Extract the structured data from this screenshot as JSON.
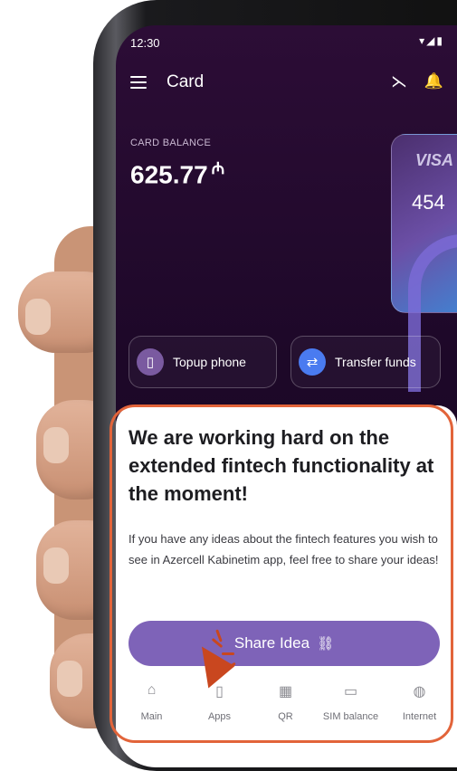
{
  "status_bar": {
    "time": "12:30"
  },
  "header": {
    "title": "Card"
  },
  "balance": {
    "label": "CARD BALANCE",
    "amount": "625.77",
    "currency_symbol": "₼"
  },
  "card": {
    "brand": "VISA",
    "number_visible": "454"
  },
  "actions": [
    {
      "label": "Topup phone",
      "icon": "phone-icon"
    },
    {
      "label": "Transfer funds",
      "icon": "transfer-icon"
    }
  ],
  "notice": {
    "headline": "We are working hard on the extended fintech functionality at the moment!",
    "description": "If you have any ideas about the fintech features you wish to see in Azercell Kabinetim app, feel free to share your ideas!",
    "button_label": "Share Idea"
  },
  "tabs": [
    {
      "label": "Main",
      "icon": "home-icon"
    },
    {
      "label": "Apps",
      "icon": "apps-icon"
    },
    {
      "label": "QR",
      "icon": "qr-icon"
    },
    {
      "label": "SIM balance",
      "icon": "wallet-icon"
    },
    {
      "label": "Internet",
      "icon": "globe-icon"
    }
  ],
  "colors": {
    "screen_bg": "#1d0828",
    "primary_button": "#7e63b8",
    "highlight": "#e2643a",
    "cursor": "#c9471f"
  }
}
